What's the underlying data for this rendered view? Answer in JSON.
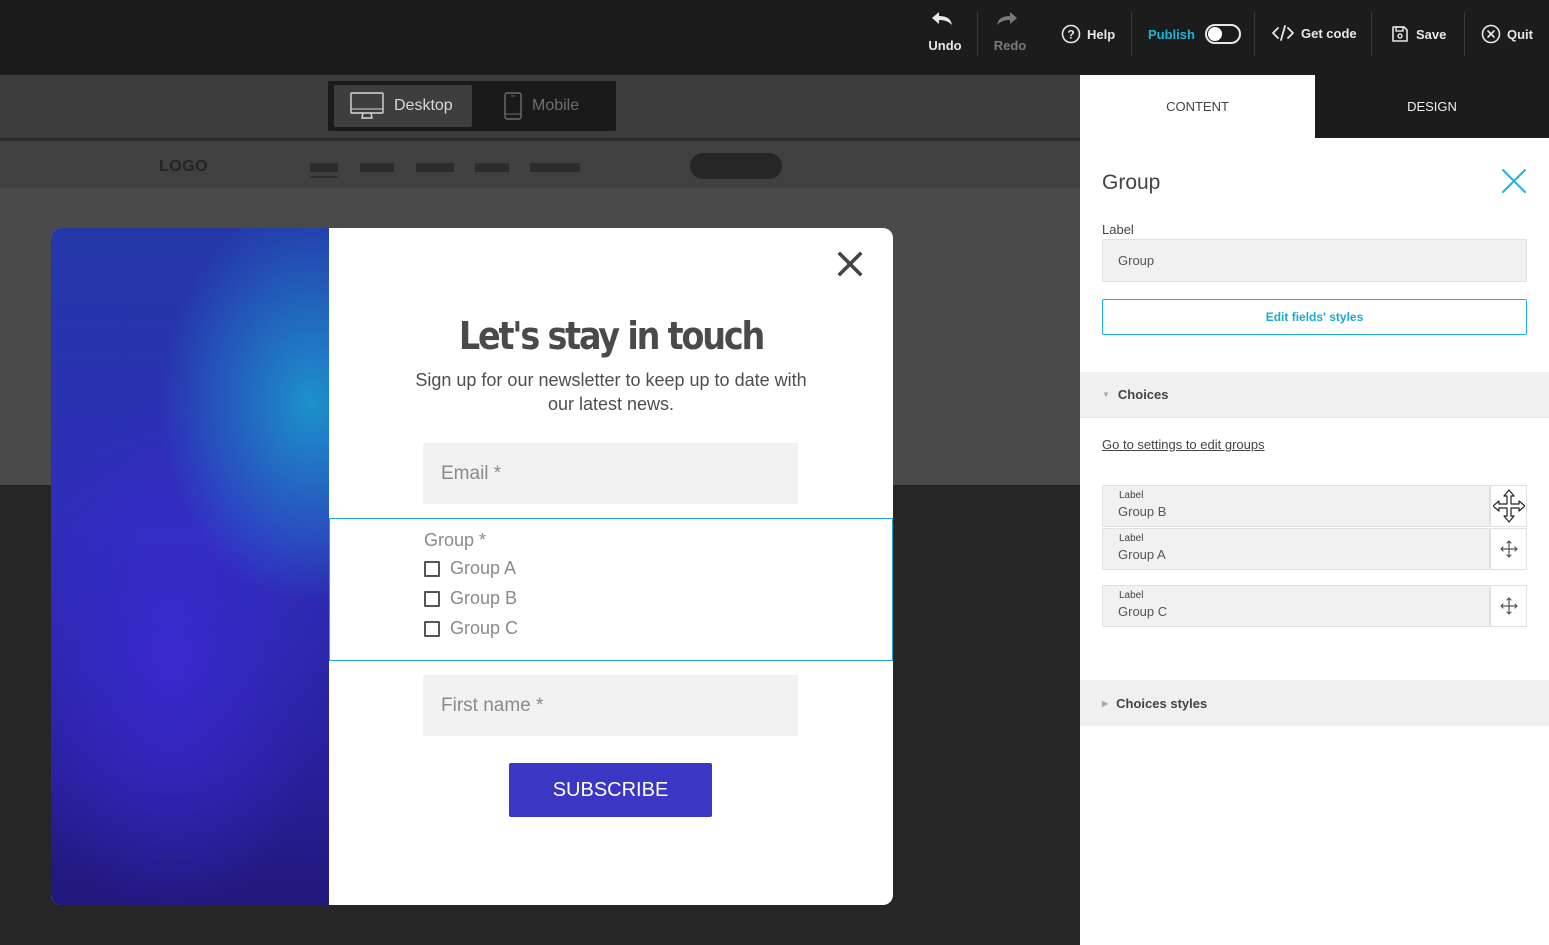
{
  "toolbar": {
    "undo_label": "Undo",
    "redo_label": "Redo",
    "help_label": "Help",
    "publish_label": "Publish",
    "getcode_label": "Get code",
    "save_label": "Save",
    "quit_label": "Quit",
    "publish_on": false
  },
  "device": {
    "desktop_label": "Desktop",
    "mobile_label": "Mobile",
    "selected": "Desktop"
  },
  "preview": {
    "logo": "LOGO"
  },
  "popup": {
    "title": "Let's stay in touch",
    "subtitle": "Sign up for our newsletter to keep up to date with our latest news.",
    "email_placeholder": "Email *",
    "group_title": "Group *",
    "choices": [
      "Group A",
      "Group B",
      "Group C"
    ],
    "firstname_placeholder": "First name *",
    "subscribe_label": "SUBSCRIBE"
  },
  "panel": {
    "tabs": [
      "CONTENT",
      "DESIGN"
    ],
    "active_tab": "CONTENT",
    "title": "Group",
    "label_caption": "Label",
    "label_value": "Group",
    "edit_styles_label": "Edit fields' styles",
    "choices_section": "Choices",
    "goto_link": "Go to settings to edit groups",
    "choice_rows": [
      {
        "label": "Label",
        "value": "Group B"
      },
      {
        "label": "Label",
        "value": "Group A"
      },
      {
        "label": "Label",
        "value": "Group C"
      }
    ],
    "choices_styles_section": "Choices styles"
  },
  "colors": {
    "accent": "#1cb4d6",
    "subscribe_button": "#3b37c4",
    "topbar": "#1c1c1c"
  },
  "icons": [
    "undo-icon",
    "redo-icon",
    "help-icon",
    "toggle-switch",
    "code-icon",
    "save-icon",
    "quit-icon",
    "desktop-icon",
    "mobile-icon",
    "close-icon",
    "move-icon"
  ]
}
